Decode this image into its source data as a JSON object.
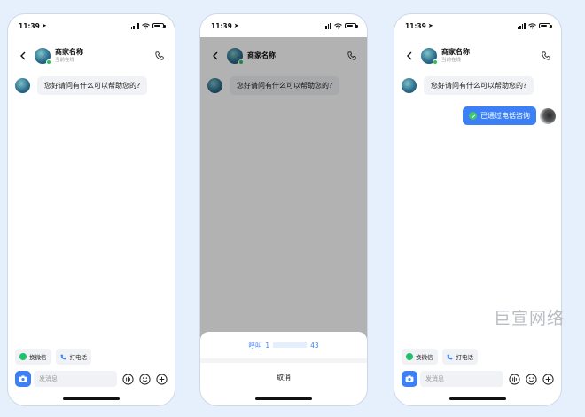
{
  "status": {
    "time": "11:39"
  },
  "header": {
    "shop_name": "商家名称",
    "shop_status": "当前在线"
  },
  "chat": {
    "greeting": "您好请问有什么可以帮助您的?",
    "call_notice": "已通过电话咨询"
  },
  "quick_actions": {
    "wechat": "换微信",
    "call": "打电话"
  },
  "input": {
    "placeholder": "发消息"
  },
  "sheet": {
    "call_label": "呼叫",
    "number_start": "1",
    "number_end": "43",
    "cancel_label": "取消"
  },
  "watermark": "巨宣网络",
  "colors": {
    "accent": "#3d80f5",
    "online": "#29c15a",
    "wechat": "#22c06b"
  }
}
